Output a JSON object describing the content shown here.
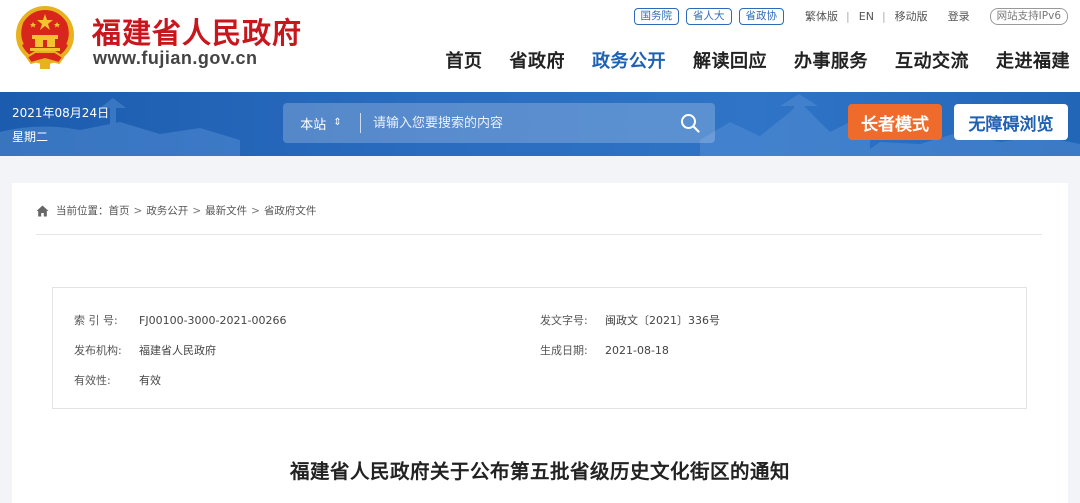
{
  "header": {
    "site_name": "福建省人民政府",
    "site_domain": "www.fujian.gov.cn",
    "top_links": {
      "gwy": "国务院",
      "srd": "省人大",
      "szx": "省政协",
      "traditional": "繁体版",
      "sep1": "|",
      "en": "EN",
      "sep2": "|",
      "mobile": "移动版",
      "login": "登录",
      "ipv6": "网站支持IPv6"
    },
    "nav": [
      "首页",
      "省政府",
      "政务公开",
      "解读回应",
      "办事服务",
      "互动交流",
      "走进福建"
    ],
    "active_nav": "政务公开"
  },
  "banner": {
    "date": "2021年08月24日",
    "weekday": "星期二",
    "search": {
      "scope": "本站",
      "scope_caret": "⇕",
      "placeholder": "请输入您要搜索的内容"
    },
    "elder_mode": "长者模式",
    "accessible": "无障碍浏览"
  },
  "breadcrumb": {
    "prefix": "当前位置：",
    "items": [
      "首页",
      "政务公开",
      "最新文件",
      "省政府文件"
    ],
    "sep": ">"
  },
  "meta": {
    "index_label": "索 引 号:",
    "index_value": "FJ00100-3000-2021-00266",
    "doc_no_label": "发文字号:",
    "doc_no_value": "闽政文〔2021〕336号",
    "publisher_label": "发布机构:",
    "publisher_value": "福建省人民政府",
    "date_label": "生成日期:",
    "date_value": "2021-08-18",
    "validity_label": "有效性:",
    "validity_value": "有效"
  },
  "document": {
    "title": "福建省人民政府关于公布第五批省级历史文化街区的通知"
  },
  "colors": {
    "brand_red": "#c8161d",
    "nav_active": "#1f61b3",
    "banner_blue": "#2a6cc0",
    "elder_orange": "#ef6b2b"
  }
}
